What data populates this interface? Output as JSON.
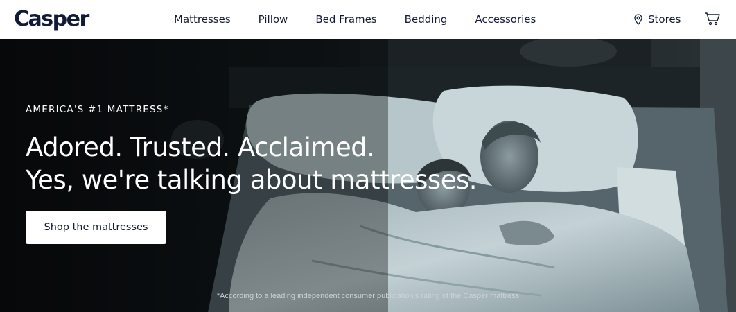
{
  "brand": {
    "logo_text": "Casper"
  },
  "nav": {
    "links": [
      "Mattresses",
      "Pillow",
      "Bed Frames",
      "Bedding",
      "Accessories"
    ],
    "stores_label": "Stores",
    "stores_icon": "map-pin-icon",
    "cart_icon": "shopping-cart-icon"
  },
  "hero": {
    "eyebrow": "AMERICA'S #1 MATTRESS*",
    "headline_line1": "Adored. Trusted. Acclaimed.",
    "headline_line2": "Yes, we're talking about mattresses.",
    "cta_label": "Shop the mattresses",
    "footnote": "*According to a leading independent consumer publication's rating of the Casper mattress"
  },
  "colors": {
    "navy": "#121a3a",
    "white": "#ffffff",
    "hero_bg": "#0f1316"
  }
}
